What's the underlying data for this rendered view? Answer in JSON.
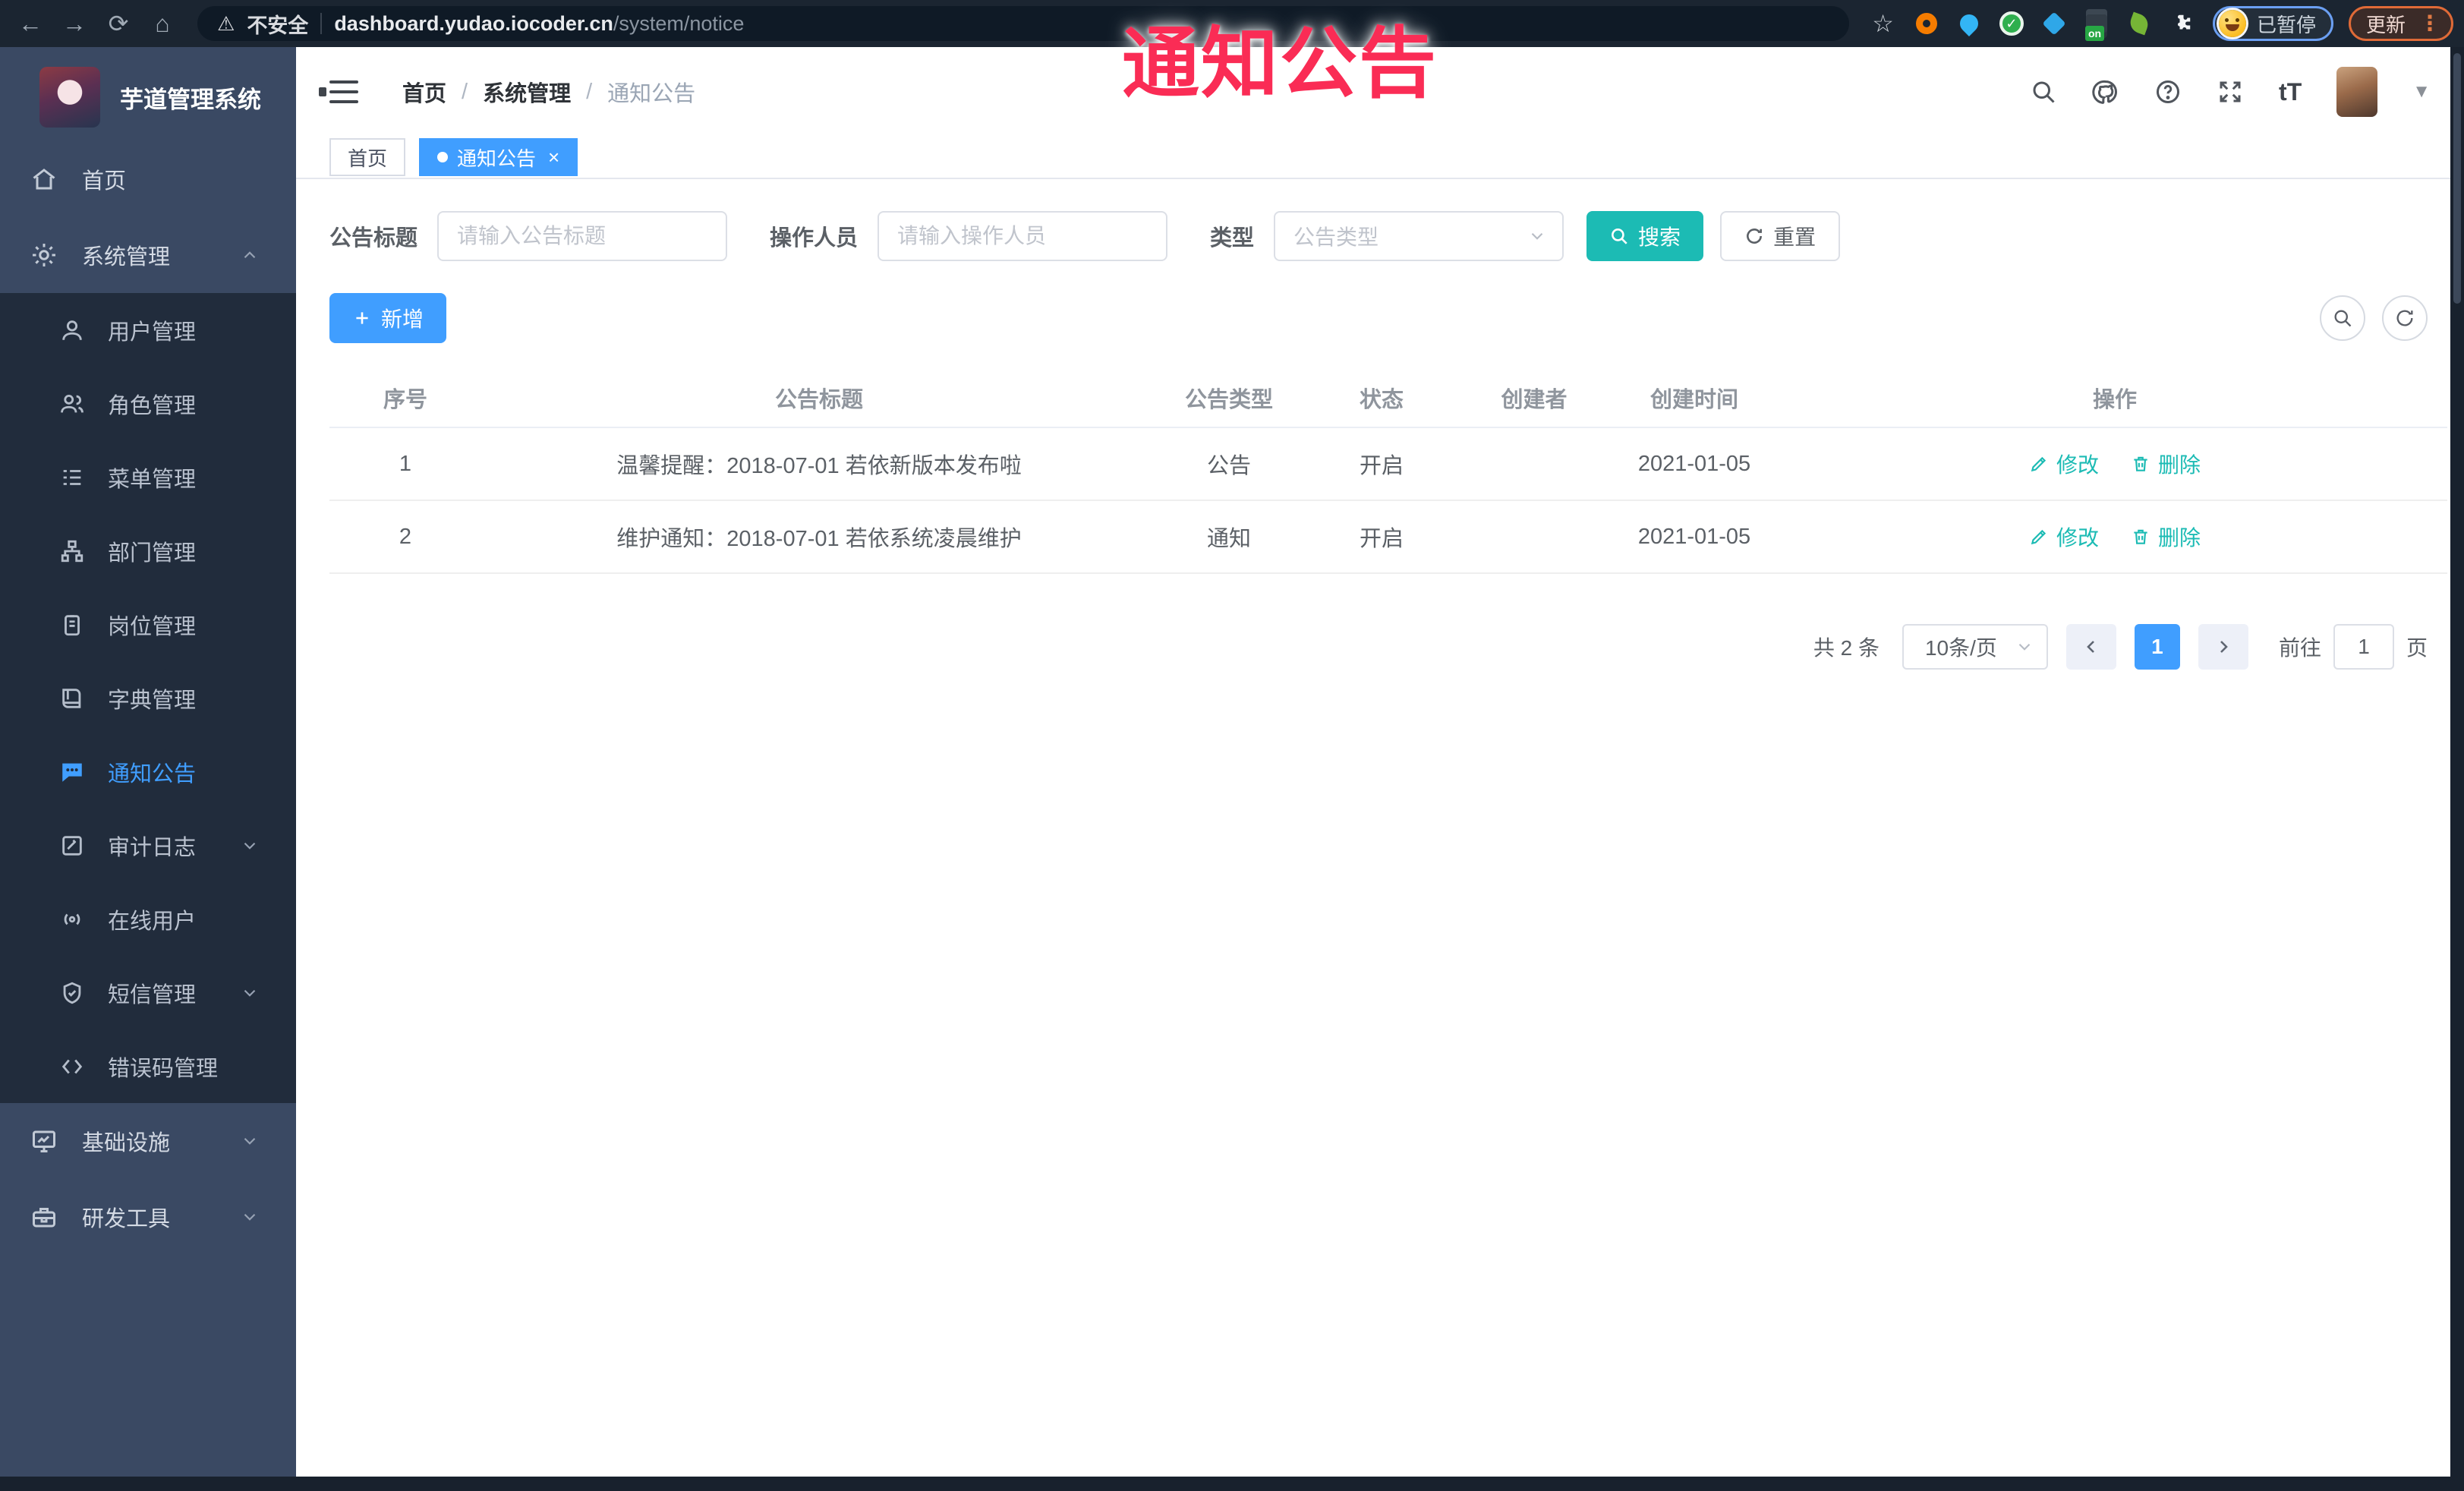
{
  "watermark": "通知公告",
  "browser": {
    "security_label": "不安全",
    "url_domain": "dashboard.yudao.iocoder.cn",
    "url_path": "/system/notice",
    "extension_badge": "on",
    "profile_status": "已暂停",
    "update_label": "更新"
  },
  "sidebar": {
    "app_title": "芋道管理系统",
    "home": "首页",
    "system": "系统管理",
    "sub": {
      "user": "用户管理",
      "role": "角色管理",
      "menu": "菜单管理",
      "dept": "部门管理",
      "post": "岗位管理",
      "dict": "字典管理",
      "notice": "通知公告",
      "audit": "审计日志",
      "online": "在线用户",
      "sms": "短信管理",
      "errcode": "错误码管理"
    },
    "infra": "基础设施",
    "dev": "研发工具"
  },
  "header": {
    "breadcrumb": [
      "首页",
      "系统管理",
      "通知公告"
    ],
    "font_size_label": "tT"
  },
  "tags": {
    "home": "首页",
    "active": "通知公告",
    "close": "×"
  },
  "filters": {
    "title_label": "公告标题",
    "title_placeholder": "请输入公告标题",
    "operator_label": "操作人员",
    "operator_placeholder": "请输入操作人员",
    "type_label": "类型",
    "type_placeholder": "公告类型",
    "search_label": "搜索",
    "reset_label": "重置"
  },
  "toolbar": {
    "add_label": "新增"
  },
  "table": {
    "headers": [
      "序号",
      "公告标题",
      "公告类型",
      "状态",
      "创建者",
      "创建时间",
      "操作"
    ],
    "rows": [
      {
        "no": "1",
        "title": "温馨提醒：2018-07-01 若依新版本发布啦",
        "type": "公告",
        "status": "开启",
        "creator": "",
        "time": "2021-01-05"
      },
      {
        "no": "2",
        "title": "维护通知：2018-07-01 若依系统凌晨维护",
        "type": "通知",
        "status": "开启",
        "creator": "",
        "time": "2021-01-05"
      }
    ],
    "edit_label": "修改",
    "delete_label": "删除"
  },
  "pagination": {
    "total": "共 2 条",
    "page_size": "10条/页",
    "current_page": "1",
    "goto_prefix": "前往",
    "goto_value": "1",
    "goto_suffix": "页"
  },
  "colors": {
    "accent": "#409EFF",
    "cyan": "#1CBBB4",
    "watermark": "#FA2C55",
    "sidebar_bg": "#3A4963",
    "submenu_bg": "#212C3C",
    "chrome_bg": "#1B2531"
  }
}
